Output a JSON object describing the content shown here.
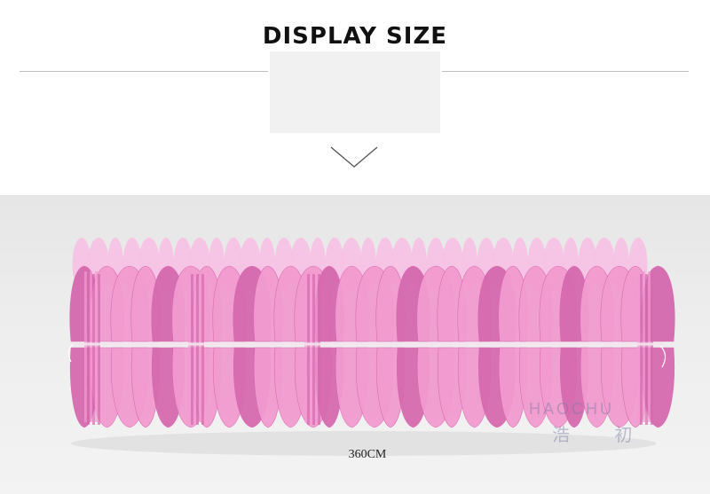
{
  "header": {
    "title": "DISPLAY SIZE"
  },
  "icons": {
    "chevron": "chevron-down-icon"
  },
  "product": {
    "size_label": "360CM",
    "watermark_latin": "HAOCHU",
    "watermark_cjk": "浩 初"
  },
  "colors": {
    "petal": "#f29bd0",
    "petal_light": "#f7c2e4",
    "petal_dark": "#d66aaf",
    "background": "#ededed"
  }
}
